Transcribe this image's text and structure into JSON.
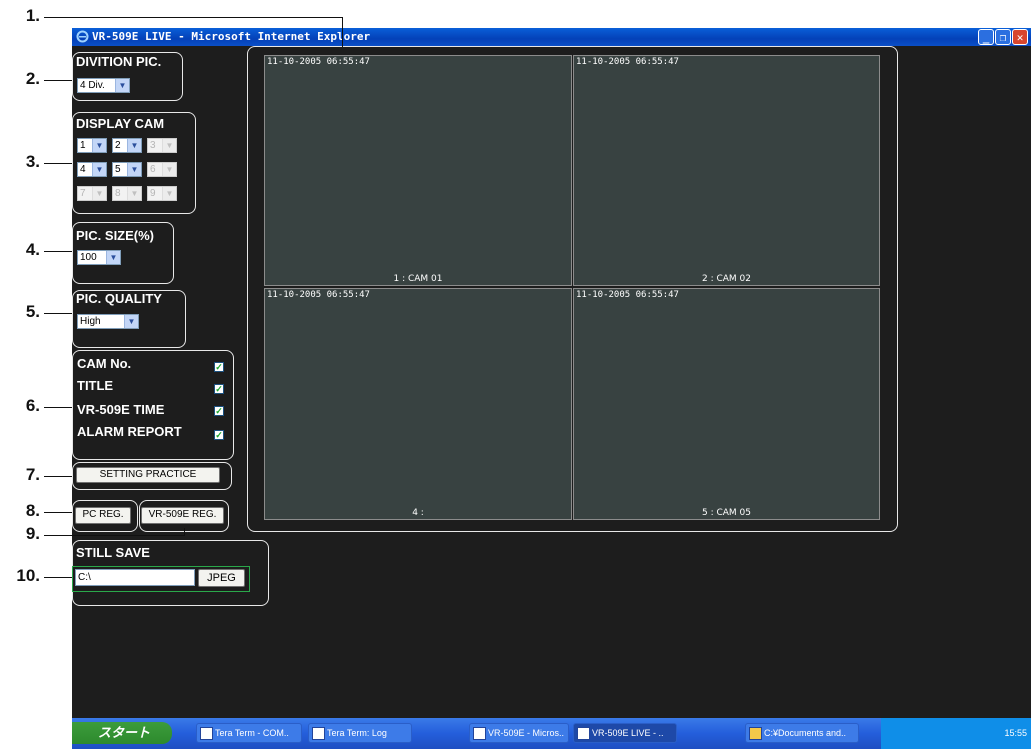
{
  "window": {
    "title": "VR-509E LIVE - Microsoft Internet Explorer",
    "min_icon": "minimize-icon",
    "max_icon": "maximize-icon",
    "close_icon": "close-icon"
  },
  "callouts": [
    "1.",
    "2.",
    "3.",
    "4.",
    "5.",
    "6.",
    "7.",
    "8.",
    "9.",
    "10."
  ],
  "division": {
    "label": "DIVITION PIC.",
    "value": "4 Div."
  },
  "display_cam": {
    "label": "DISPLAY CAM",
    "cells": [
      "1",
      "2",
      "3",
      "4",
      "5",
      "6",
      "7",
      "8",
      "9"
    ]
  },
  "pic_size": {
    "label": "PIC. SIZE(%)",
    "value": "100"
  },
  "pic_quality": {
    "label": "PIC. QUALITY",
    "value": "High"
  },
  "options": [
    {
      "label": "CAM No.",
      "checked": true
    },
    {
      "label": "TITLE",
      "checked": true
    },
    {
      "label": "VR-509E TIME",
      "checked": true
    },
    {
      "label": "ALARM REPORT",
      "checked": true
    }
  ],
  "setting_practice": "SETTING PRACTICE",
  "pc_reg": "PC REG.",
  "vr_reg": "VR-509E REG.",
  "still_save": {
    "label": "STILL SAVE",
    "path": "C:\\",
    "format_button": "JPEG"
  },
  "cameras": [
    {
      "timestamp": "11-10-2005 06:55:47",
      "name": "1 : CAM 01"
    },
    {
      "timestamp": "11-10-2005 06:55:47",
      "name": "2 : CAM 02"
    },
    {
      "timestamp": "11-10-2005 06:55:47",
      "name": "4 :"
    },
    {
      "timestamp": "11-10-2005 06:55:47",
      "name": "5 : CAM 05"
    }
  ],
  "taskbar": {
    "start": "スタート",
    "tasks": [
      "Tera Term - COM..",
      "Tera Term: Log",
      "VR-509E - Micros..",
      "VR-509E LIVE - ..",
      "C:¥Documents and.."
    ],
    "clock": "15:55"
  },
  "colors": {
    "accent": "#245edb",
    "checkmark": "#1aa62a",
    "camera_bg": "#384241"
  }
}
